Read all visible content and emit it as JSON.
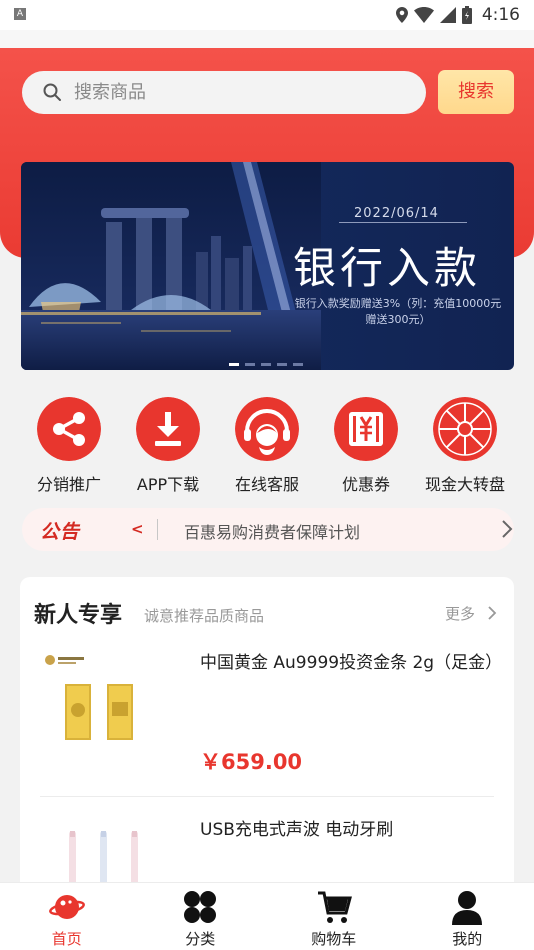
{
  "status_bar": {
    "time": "4:16",
    "notification_badge": "A",
    "icons": [
      "location-icon",
      "wifi-icon",
      "signal-icon",
      "battery-icon"
    ]
  },
  "colors": {
    "brand_red": "#e8362e",
    "search_button_bg": "#ffd88c",
    "banner_bg": "#13285a"
  },
  "search": {
    "placeholder": "搜索商品",
    "button_label": "搜索"
  },
  "banner": {
    "date": "2022/06/14",
    "headline": "银行入款",
    "subtext": "银行入款奖励赠送3%（列：充值10000元赠送300元）",
    "slide_count": 5,
    "active_slide": 1
  },
  "shortcuts": [
    {
      "label": "分销推广",
      "icon": "share-icon"
    },
    {
      "label": "APP下载",
      "icon": "download-icon"
    },
    {
      "label": "在线客服",
      "icon": "customer-service-icon"
    },
    {
      "label": "优惠券",
      "icon": "coupon-icon"
    },
    {
      "label": "现金大转盘",
      "icon": "prize-wheel-icon"
    }
  ],
  "notice": {
    "tag": "公告",
    "text": "百惠易购消费者保障计划"
  },
  "new_user_section": {
    "title": "新人专享",
    "subtitle": "诚意推荐品质商品",
    "more_label": "更多",
    "products": [
      {
        "name": "中国黄金 Au9999投资金条 2g（足金）",
        "price": "￥659.00",
        "image": "gold-bar-image"
      },
      {
        "name": "USB充电式声波 电动牙刷",
        "price": "",
        "image": "toothbrush-image"
      }
    ]
  },
  "tab_bar": {
    "active": "首页",
    "tabs": [
      {
        "label": "首页",
        "icon": "home-planet-icon"
      },
      {
        "label": "分类",
        "icon": "category-icon"
      },
      {
        "label": "购物车",
        "icon": "cart-icon"
      },
      {
        "label": "我的",
        "icon": "user-icon"
      }
    ]
  }
}
